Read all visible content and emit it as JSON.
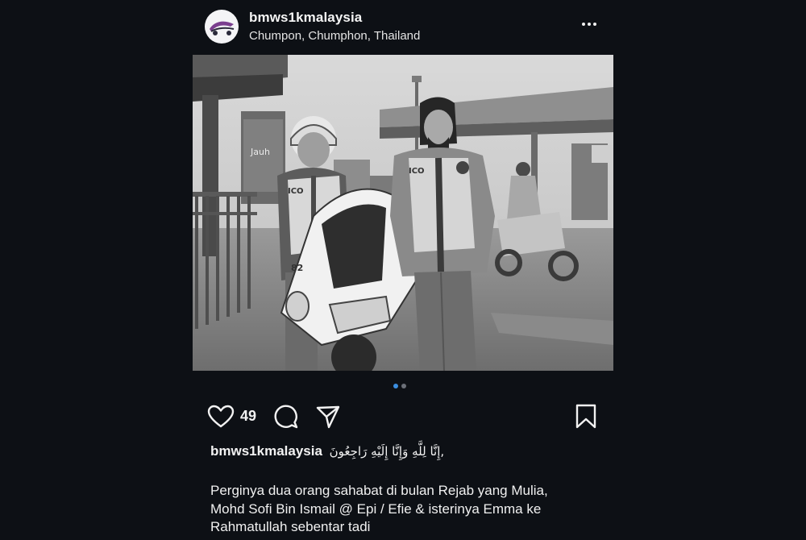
{
  "post": {
    "username": "bmws1kmalaysia",
    "location": "Chumpon, Chumphon, Thailand"
  },
  "photo": {
    "signs": {
      "shop_sign": "Jauh",
      "jacket_text_left": "ICO",
      "jacket_text_right": "ICO",
      "bike_number": "82"
    }
  },
  "carousel": {
    "total": 2,
    "active": 1
  },
  "actions": {
    "like_count": "49",
    "icons": [
      "heart-icon",
      "comment-icon",
      "share-icon",
      "bookmark-icon"
    ]
  },
  "caption": {
    "username": "bmws1kmalaysia",
    "arabic_text": "إِنَّا لِلَّهِ وَإِنَّا إِلَيْهِ رَاجِعُونَ,",
    "lines": [
      "Perginya dua orang sahabat di bulan Rejab yang Mulia,",
      "Mohd Sofi Bin Ismail @ Epi / Efie & isterinya Emma ke",
      "Rahmatullah sebentar tadi"
    ]
  },
  "colors": {
    "background": "#0d1015",
    "text": "#f2f2f2",
    "active_dot": "#3b8ee0",
    "inactive_dot": "#6b6f78"
  }
}
